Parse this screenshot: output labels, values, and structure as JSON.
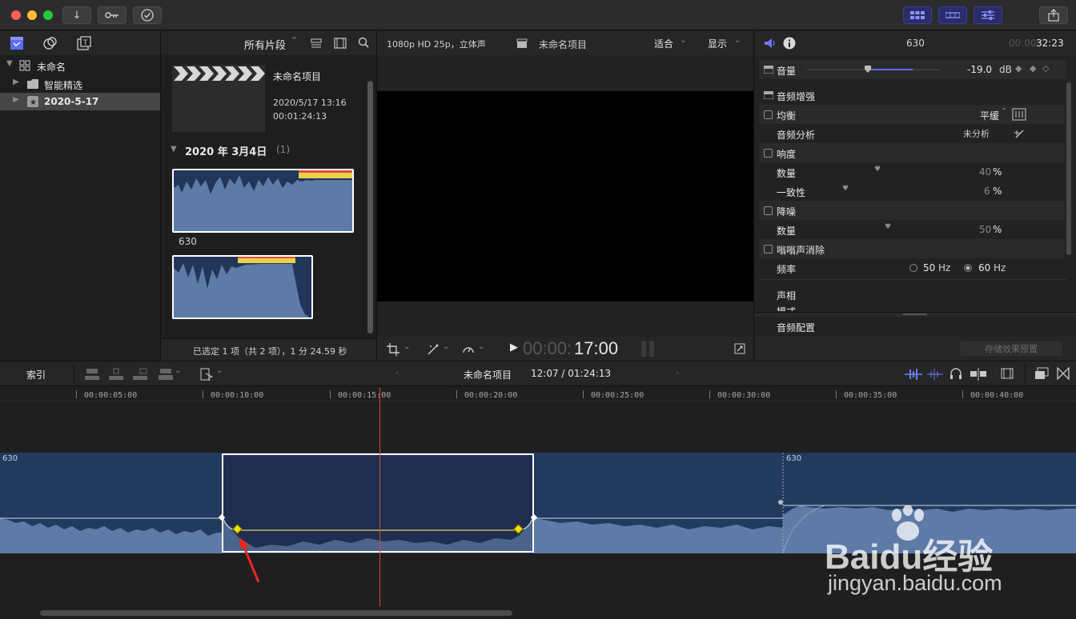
{
  "toolbar": {
    "import_icon": "↓",
    "keyword_icon": "key",
    "check_icon": "✓"
  },
  "library": {
    "root_label": "未命名",
    "items": [
      {
        "label": "智能精选"
      },
      {
        "label": "2020-5-17"
      }
    ]
  },
  "browser": {
    "filter_label": "所有片段",
    "project": {
      "name": "未命名项目",
      "date": "2020/5/17 13:16",
      "duration": "00:01:24:13"
    },
    "group_date": "2020 年 3月4日",
    "group_count": "(1)",
    "clip_name": "630",
    "status": "已选定 1 项（共 2 项），1 分 24.59 秒"
  },
  "viewer": {
    "format": "1080p HD 25p，立体声",
    "project_name": "未命名项目",
    "fit_label": "适合",
    "display_label": "显示",
    "timecode_dim": "00:00:",
    "timecode": "17:00"
  },
  "inspector": {
    "clip_name": "630",
    "time_dim": "00:00",
    "time": "32:23",
    "volume_label": "音量",
    "volume_value": "-19.0",
    "volume_unit": "dB",
    "enhance_label": "音频增强",
    "eq_label": "均衡",
    "eq_value": "平缓",
    "analysis_label": "音频分析",
    "analysis_value": "未分析",
    "loudness_label": "响度",
    "amount_label": "数量",
    "amount_value": "40",
    "uniformity_label": "一致性",
    "uniformity_value": "6",
    "noise_label": "降噪",
    "noise_amount_label": "数量",
    "noise_amount_value": "50",
    "percent": "%",
    "hum_label": "嗡嗡声消除",
    "freq_label": "频率",
    "freq_50": "50",
    "freq_60": "60",
    "hz": "Hz",
    "pan_label": "声相",
    "pan_sub": "模式",
    "audio_config_label": "音频配置",
    "save_preset_label": "存储效果预置"
  },
  "timeline": {
    "index_label": "索引",
    "project_name": "未命名项目",
    "position": "12:07 / 01:24:13",
    "clip_label_1": "630",
    "clip_label_2": "630",
    "ruler": [
      {
        "label": "00:00:05:00"
      },
      {
        "label": "00:00:10:00"
      },
      {
        "label": "00:00:15:00"
      },
      {
        "label": "00:00:20:00"
      },
      {
        "label": "00:00:25:00"
      },
      {
        "label": "00:00:30:00"
      },
      {
        "label": "00:00:35:00"
      },
      {
        "label": "00:00:40:00"
      }
    ]
  },
  "watermark": {
    "brand": "Baidu经验",
    "url": "jingyan.baidu.com"
  },
  "colors": {
    "accent": "#5b6cff",
    "waveform": "#5e7ba8",
    "clip_bg": "#223a5e",
    "playhead": "#e0452b",
    "keyframe": "#f5e100"
  }
}
